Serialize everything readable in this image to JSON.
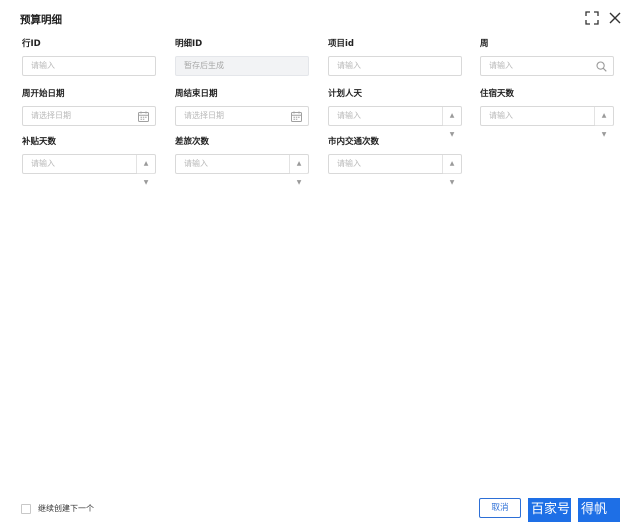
{
  "dialog": {
    "title": "预算明细"
  },
  "fields": [
    {
      "label": "行ID",
      "placeholder": "请输入"
    },
    {
      "label": "明细ID",
      "placeholder": "暂存后生成"
    },
    {
      "label": "项目id",
      "placeholder": "请输入"
    },
    {
      "label": "周",
      "placeholder": "请输入"
    },
    {
      "label": "周开始日期",
      "placeholder": "请选择日期"
    },
    {
      "label": "周结束日期",
      "placeholder": "请选择日期"
    },
    {
      "label": "计划人天",
      "placeholder": "请输入"
    },
    {
      "label": "住宿天数",
      "placeholder": "请输入"
    },
    {
      "label": "补贴天数",
      "placeholder": "请输入"
    },
    {
      "label": "差旅次数",
      "placeholder": "请输入"
    },
    {
      "label": "市内交通次数",
      "placeholder": "请输入"
    }
  ],
  "footer": {
    "continue_label": "继续创建下一个",
    "cancel_label": "取消",
    "save_label": "百家号",
    "confirm_label": "得帆"
  },
  "colors": {
    "primary": "#1e6fe6",
    "border": "#d9d9d9",
    "disabled_bg": "#f2f3f5"
  }
}
